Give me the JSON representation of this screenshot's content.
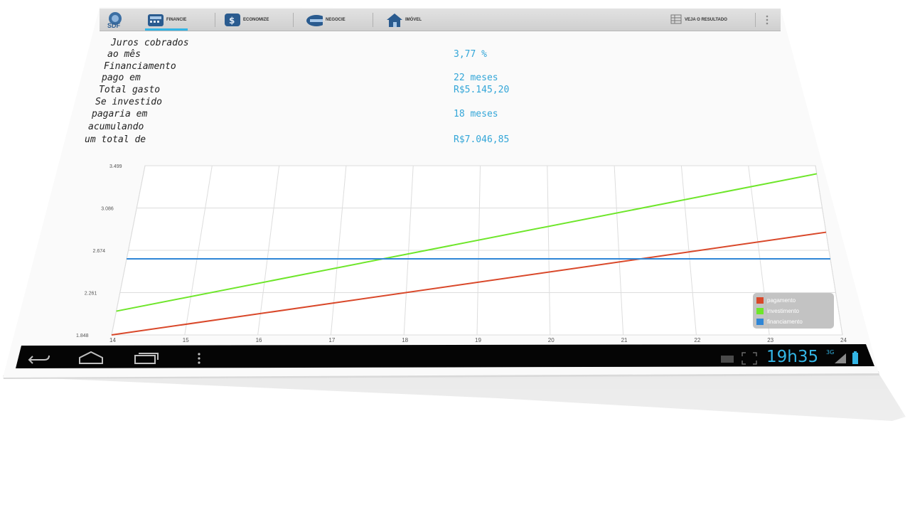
{
  "app": {
    "logo_text": "SDF",
    "tabs": [
      {
        "label": "FINANCIE",
        "icon": "calculator-icon",
        "active": true
      },
      {
        "label": "ECONOMIZE",
        "icon": "savings-icon",
        "active": false
      },
      {
        "label": "NEGOCIE",
        "icon": "handshake-icon",
        "active": false
      },
      {
        "label": "IMÓVEL",
        "icon": "house-icon",
        "active": false
      }
    ],
    "result_button_label": "VEJA O RESULTADO",
    "accent_color": "#33b5e5"
  },
  "results": {
    "juros_label_1": "Juros cobrados",
    "juros_label_2": "ao mês",
    "juros_value": "3,77 %",
    "financiamento_label_1": "Financiamento",
    "financiamento_label_2": "pago em",
    "financiamento_value": "22 meses",
    "total_label": "Total gasto",
    "total_value": "R$5.145,20",
    "investido_label_1": "Se investido",
    "investido_label_2": "pagaria em",
    "investido_value": "18 meses",
    "acumulando_label_1": "acumulando",
    "acumulando_label_2": "um total de",
    "acumulando_value": "R$7.046,85"
  },
  "chart_data": {
    "type": "line",
    "title": "",
    "xlabel": "",
    "ylabel": "",
    "x_ticks": [
      "14",
      "15",
      "16",
      "17",
      "18",
      "19",
      "20",
      "21",
      "22",
      "23",
      "24"
    ],
    "y_ticks": [
      "1.848",
      "2.261",
      "2.674",
      "3.086",
      "3.499"
    ],
    "xlim": [
      14,
      24
    ],
    "ylim": [
      1848,
      3499
    ],
    "grid": true,
    "legend_position": "bottom-right",
    "series": [
      {
        "name": "pagamento",
        "color": "#d9482a",
        "x": [
          14,
          24
        ],
        "y": [
          1848,
          2850
        ]
      },
      {
        "name": "investimento",
        "color": "#6ee62a",
        "x": [
          14,
          24
        ],
        "y": [
          2080,
          3420
        ]
      },
      {
        "name": "financiamento",
        "color": "#2f86d6",
        "x": [
          14,
          24
        ],
        "y": [
          2590,
          2590
        ]
      }
    ]
  },
  "nav": {
    "clock": "19h35",
    "signal_label": "3G"
  }
}
